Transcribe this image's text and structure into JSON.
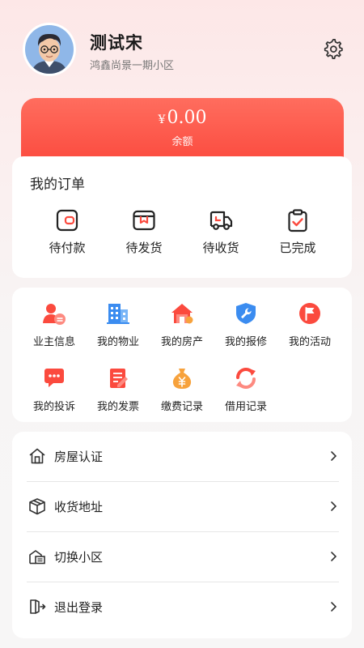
{
  "profile": {
    "name": "测试宋",
    "community": "鸿鑫尚景一期小区",
    "avatar_icon": "cartoon-avatar-glasses",
    "settings_icon": "gear-icon"
  },
  "balance": {
    "currency": "¥",
    "amount": "0.00",
    "label": "余额"
  },
  "orders": {
    "title": "我的订单",
    "items": [
      {
        "label": "待付款",
        "icon": "wallet-icon"
      },
      {
        "label": "待发货",
        "icon": "package-icon"
      },
      {
        "label": "待收货",
        "icon": "truck-icon"
      },
      {
        "label": "已完成",
        "icon": "clipboard-check-icon"
      }
    ]
  },
  "services": {
    "items": [
      {
        "label": "业主信息",
        "icon": "owner-info-icon"
      },
      {
        "label": "我的物业",
        "icon": "building-icon"
      },
      {
        "label": "我的房产",
        "icon": "house-icon"
      },
      {
        "label": "我的报修",
        "icon": "wrench-shield-icon"
      },
      {
        "label": "我的活动",
        "icon": "flag-icon"
      },
      {
        "label": "我的投诉",
        "icon": "chat-bubble-icon"
      },
      {
        "label": "我的发票",
        "icon": "invoice-icon"
      },
      {
        "label": "缴费记录",
        "icon": "money-bag-icon"
      },
      {
        "label": "借用记录",
        "icon": "refresh-icon"
      }
    ]
  },
  "menu": {
    "items": [
      {
        "label": "房屋认证",
        "icon": "house-outline-icon"
      },
      {
        "label": "收货地址",
        "icon": "box-outline-icon"
      },
      {
        "label": "切换小区",
        "icon": "switch-community-icon"
      },
      {
        "label": "退出登录",
        "icon": "logout-icon"
      }
    ]
  },
  "colors": {
    "accent": "#fb4a3e",
    "accent_light": "#ff6d5e",
    "orange": "#f7a23c",
    "blue": "#3b8cf0"
  }
}
